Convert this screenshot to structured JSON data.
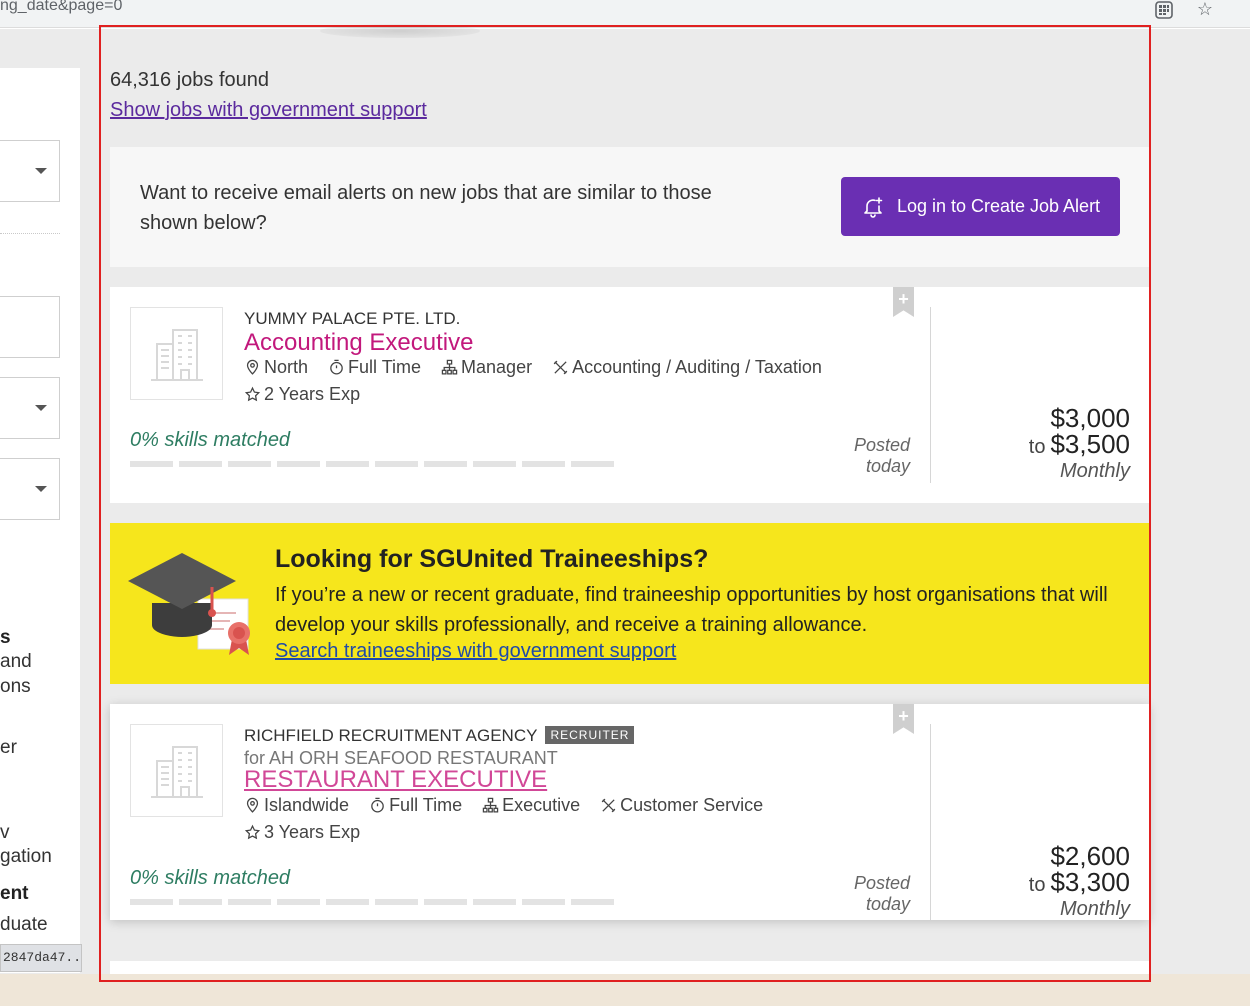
{
  "browser": {
    "url_fragment": "ng_date&page=0"
  },
  "sidebar": {
    "fragments": [
      "s",
      "and",
      "ons",
      "er",
      "v",
      "gation",
      "ent",
      "duate"
    ],
    "status_text": "2847da47..."
  },
  "results": {
    "count_text": "64,316 jobs found",
    "gov_link": "Show jobs with government support"
  },
  "alert": {
    "text": "Want to receive email alerts on new jobs that are similar to those shown below?",
    "button_label": "Log in to Create Job Alert"
  },
  "jobs": [
    {
      "company": "YUMMY PALACE PTE. LTD.",
      "title": "Accounting Executive",
      "location": "North",
      "employment": "Full Time",
      "level": "Manager",
      "category": "Accounting / Auditing / Taxation",
      "experience": "2 Years Exp",
      "skills_matched": "0% skills matched",
      "skills_fraction": 0,
      "posted": "Posted today",
      "salary_from": "$3,000",
      "salary_to_word": "to",
      "salary_to": "$3,500",
      "salary_period": "Monthly",
      "bookmark_glyph": "+"
    },
    {
      "company": "RICHFIELD RECRUITMENT AGENCY",
      "badge": "RECRUITER",
      "for_company": "for AH ORH SEAFOOD RESTAURANT",
      "title": "RESTAURANT EXECUTIVE",
      "location": "Islandwide",
      "employment": "Full Time",
      "level": "Executive",
      "category": "Customer Service",
      "experience": "3 Years Exp",
      "skills_matched": "0% skills matched",
      "skills_fraction": 0,
      "posted": "Posted today",
      "salary_from": "$2,600",
      "salary_to_word": "to",
      "salary_to": "$3,300",
      "salary_period": "Monthly",
      "bookmark_glyph": "+"
    }
  ],
  "promo": {
    "title": "Looking for SGUnited Traineeships?",
    "body": "If you’re a new or recent graduate, find traineeship opportunities by host organisations that will develop your skills professionally, and receive a training allowance.",
    "link": "Search traineeships with government support"
  },
  "colors": {
    "accent_purple": "#6a2fb3",
    "job_title_pink": "#c2187c",
    "skills_green": "#2e7d62",
    "promo_yellow": "#f6e61c",
    "focus_red": "#e02020"
  },
  "icons": [
    "apps-icon",
    "star-icon",
    "bell-plus-icon",
    "location-pin-icon",
    "stopwatch-icon",
    "org-chart-icon",
    "tools-icon",
    "star-outline-icon",
    "building-icon",
    "bookmark-icon",
    "graduation-cap-icon",
    "certificate-icon"
  ]
}
